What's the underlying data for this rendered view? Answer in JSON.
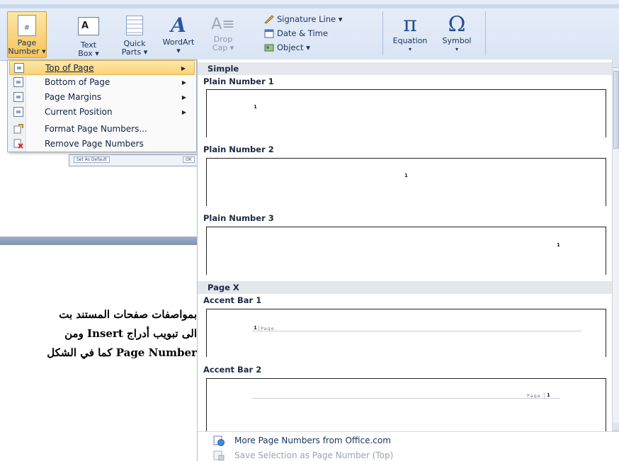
{
  "ribbon": {
    "page_number": {
      "line1": "Page",
      "line2": "Number ▾"
    },
    "text_box": {
      "line1": "Text",
      "line2": "Box ▾"
    },
    "quick_parts": {
      "line1": "Quick",
      "line2": "Parts ▾"
    },
    "wordart": {
      "line1": "WordArt",
      "line2": "▾"
    },
    "drop_cap": {
      "line1": "Drop",
      "line2": "Cap ▾"
    },
    "signature_line": "Signature Line ▾",
    "date_time": "Date & Time",
    "object": "Object ▾",
    "equation": "Equation",
    "equation_symbol": "π",
    "symbol": "Symbol",
    "symbol_glyph": "Ω",
    "equation_arrow": "▾",
    "symbol_arrow": "▾"
  },
  "menu": {
    "items": [
      {
        "label": "Top of Page",
        "icon": "page-top-icon",
        "has_submenu": true,
        "highlighted": true
      },
      {
        "label": "Bottom of Page",
        "icon": "page-bottom-icon",
        "has_submenu": true
      },
      {
        "label": "Page Margins",
        "icon": "page-margins-icon",
        "has_submenu": true
      },
      {
        "label": "Current Position",
        "icon": "current-position-icon",
        "has_submenu": true
      },
      {
        "label": "Format Page Numbers...",
        "icon": "format-page-numbers-icon"
      },
      {
        "label": "Remove Page Numbers",
        "icon": "remove-page-numbers-icon"
      }
    ],
    "arrow": "▶"
  },
  "dialog_glimpse": {
    "set_default": "Set As Default",
    "ok": "OK"
  },
  "gallery": {
    "sections": [
      {
        "label": "Simple"
      },
      {
        "label": "Page X"
      }
    ],
    "items": [
      {
        "title": "Plain Number 1",
        "number": "1"
      },
      {
        "title": "Plain Number 2",
        "number": "1"
      },
      {
        "title": "Plain Number 3",
        "number": "1"
      },
      {
        "title": "Accent Bar 1",
        "number": "1",
        "page_label": "Page"
      },
      {
        "title": "Accent Bar 2",
        "number": "1",
        "page_label": "Page"
      }
    ],
    "separator": "|",
    "footer": [
      {
        "label": "More Page Numbers from Office.com",
        "icon": "office-online-icon",
        "enabled": true
      },
      {
        "label": "Save Selection as Page Number (Top)",
        "icon": "save-selection-icon",
        "enabled": false
      }
    ]
  },
  "document": {
    "lines": [
      "بمواصفات صفحات المستند بت",
      "الى تبويب أدراج Insert ومن",
      "Page Number كما في الشكل"
    ]
  },
  "colors": {
    "highlight": "#f9d277",
    "ribbon": "#dfe8f5",
    "section_bg": "#e4e7ec"
  }
}
